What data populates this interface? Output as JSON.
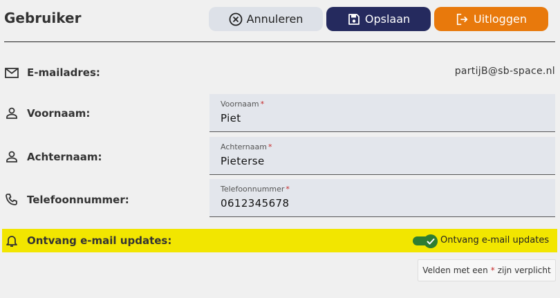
{
  "header": {
    "title": "Gebruiker",
    "cancel_label": "Annuleren",
    "save_label": "Opslaan",
    "logout_label": "Uitloggen"
  },
  "rows": {
    "email": {
      "label": "E-mailadres:",
      "value": "partijB@sb-space.nl",
      "icon": "mail-icon"
    },
    "first_name": {
      "label": "Voornaam:",
      "field_label": "Voornaam",
      "value": "Piet",
      "icon": "person-icon"
    },
    "last_name": {
      "label": "Achternaam:",
      "field_label": "Achternaam",
      "value": "Pieterse",
      "icon": "person-icon"
    },
    "phone": {
      "label": "Telefoonnummer:",
      "field_label": "Telefoonnummer",
      "value": "0612345678",
      "icon": "phone-icon"
    },
    "updates": {
      "label": "Ontvang e-mail updates:",
      "toggle_label": "Ontvang e-mail updates",
      "enabled": true,
      "icon": "bell-icon"
    }
  },
  "footer": {
    "required_prefix": "Velden met een",
    "required_marker": "*",
    "required_suffix": "zijn verplicht"
  },
  "colors": {
    "background": "#f0f0f0",
    "save_button": "#252a5e",
    "logout_button": "#e8790c",
    "cancel_button": "#dde1e8",
    "highlight": "#f2e600",
    "toggle_on": "#2e7d32",
    "required": "#c62828"
  }
}
